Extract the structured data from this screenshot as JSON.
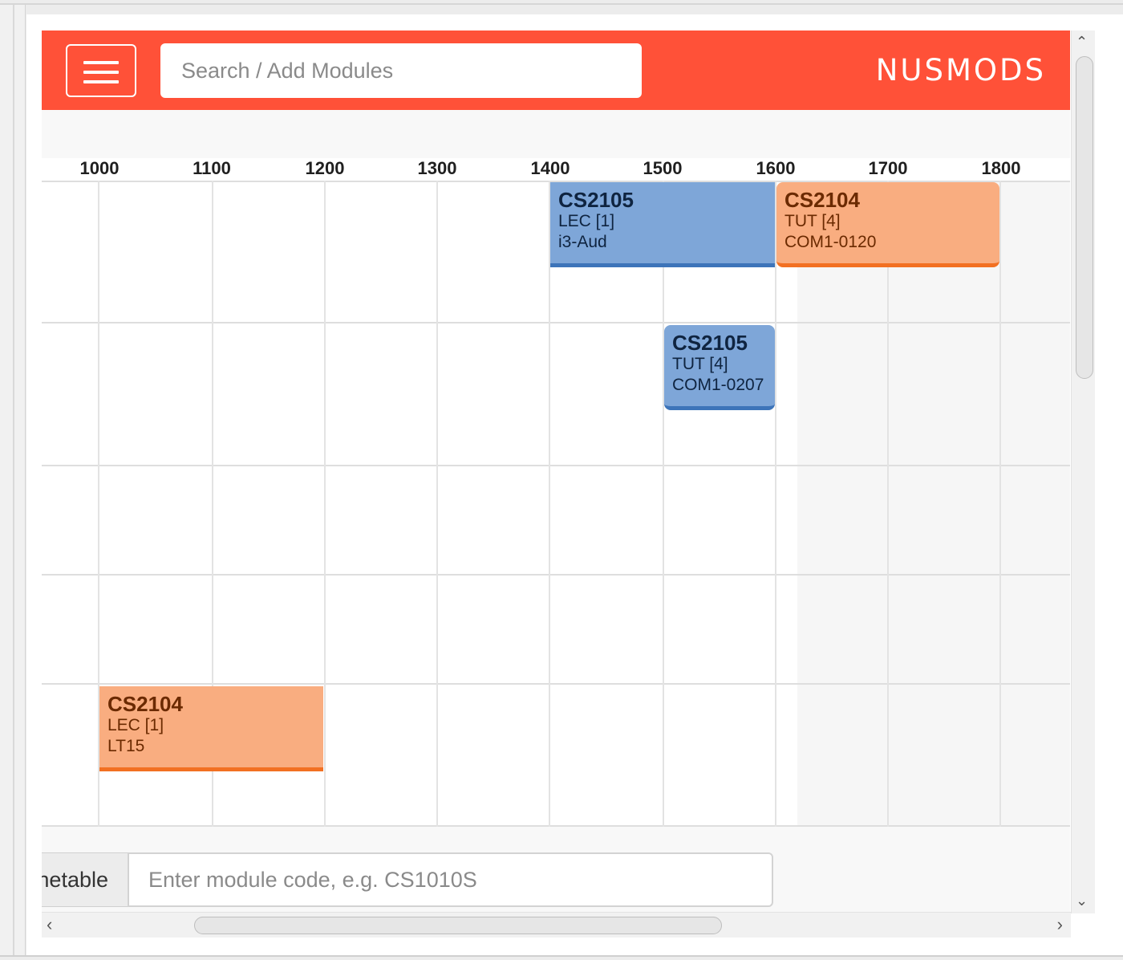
{
  "navbar": {
    "search_placeholder": "Search / Add Modules",
    "brand": "NUSMODS",
    "color": "#ff5138"
  },
  "timetable": {
    "time_labels": [
      "1000",
      "1100",
      "1200",
      "1300",
      "1400",
      "1500",
      "1600",
      "1700",
      "1800"
    ],
    "lessons": [
      {
        "code": "CS2105",
        "type": "LEC [1]",
        "venue": "i3-Aud",
        "color": "#7ea6d8"
      },
      {
        "code": "CS2104",
        "type": "TUT [4]",
        "venue": "COM1-0120",
        "color": "#f9ad80"
      },
      {
        "code": "CS2105",
        "type": "TUT [4]",
        "venue": "COM1-0207",
        "color": "#7ea6d8"
      },
      {
        "code": "CS2104",
        "type": "LEC [1]",
        "venue": "LT15",
        "color": "#f9ad80"
      }
    ]
  },
  "add_module": {
    "label": "netable",
    "placeholder": "Enter module code, e.g. CS1010S"
  },
  "icons": {
    "menu": "hamburger-menu-icon",
    "scroll_up": "chevron-up-icon",
    "scroll_down": "chevron-down-icon",
    "scroll_left": "chevron-left-icon",
    "scroll_right": "chevron-right-icon"
  }
}
